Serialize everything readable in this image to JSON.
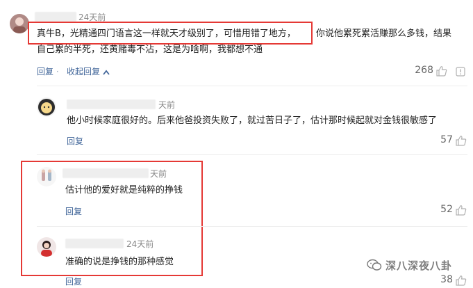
{
  "comments": [
    {
      "time": "24天前",
      "text_line1_highlighted": "真牛B，光精通四门语言这一样就天才级别了，可惜用错了地方，",
      "text_line1_rest": "你说他累死累活赚那么多钱，结果",
      "text_line2": "自己累的半死，还黄赌毒不沾，这是为啥啊，我都想不通",
      "reply_label": "回复",
      "separator": "·",
      "collapse_label": "收起回复",
      "like_count": "268"
    }
  ],
  "replies": [
    {
      "time": "天前",
      "text": "他小时候家庭很好的。后来他爸投资失败了，就过苦日子了，估计那时候起就对金钱很敏感了",
      "reply_label": "回复",
      "like_count": "57"
    },
    {
      "time": "天前",
      "text": "估计他的爱好就是纯粹的挣钱",
      "reply_label": "回复",
      "like_count": "52"
    },
    {
      "time": "24天前",
      "text": "准确的说是挣钱的那种感觉",
      "reply_label": "回复",
      "like_count": "38"
    }
  ],
  "watermark": {
    "text": "深八深夜八卦"
  },
  "colors": {
    "highlight_border": "#e53935",
    "link": "#406599",
    "muted": "#888888"
  },
  "icons": [
    "like-icon",
    "report-icon",
    "chevron-up-icon",
    "wechat-icon"
  ]
}
